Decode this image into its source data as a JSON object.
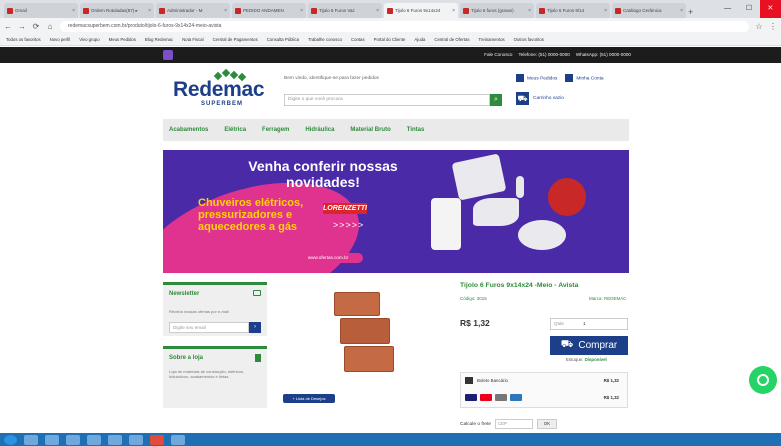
{
  "browser": {
    "tabs": [
      {
        "label": "Gmail",
        "active": false
      },
      {
        "label": "Ordem Rotuladas(87) ▸",
        "active": false
      },
      {
        "label": "Administrador - M",
        "active": false
      },
      {
        "label": "PEDIDO ANDAMEN",
        "active": false
      },
      {
        "label": "Tijolo 6 Furos Vaz",
        "active": false
      },
      {
        "label": "Tijolo 6 Furos 9x14x24",
        "active": true
      },
      {
        "label": "Tijolo 6 furos (gravar)",
        "active": false
      },
      {
        "label": "Tijolo 6 Furos 9/14",
        "active": false
      },
      {
        "label": "Catálogo Cerâmica",
        "active": false
      }
    ],
    "url": "redemacsuperbem.com.br/produto/tijolo-6-furos-9x14x24-meio-avista",
    "bookmarks": [
      "Todos os favoritos",
      "Novo perfil",
      "Vivo grupo",
      "Meus Pedidos",
      "Blog Redemac",
      "Nota Fiscal",
      "Central de Pagamentos",
      "Consulta Pública",
      "Trabalhe conosco",
      "Contas",
      "Portal do Cliente",
      "Ajuda",
      "Central de Ofertas",
      "Treinamentos",
      "Outros favoritos"
    ]
  },
  "topbar": {
    "info": [
      "Fale Conosco",
      "Telefone: (51) 0000-0000",
      "WhatsApp: (51) 0000-0000"
    ]
  },
  "header": {
    "logo": "Redemac",
    "logo_sub": "SUPERBEM",
    "welcome": "Bem vindo, identifique-se para fazer pedidos",
    "search_placeholder": "Digite o que você procura",
    "my_orders": "Meus Pedidos",
    "my_account": "Minha Conta",
    "cart": "Carrinho vazio"
  },
  "menu": [
    "Acabamentos",
    "Elétrica",
    "Ferragem",
    "Hidráulica",
    "Material Bruto",
    "Tintas"
  ],
  "banner": {
    "headline": "Venha conferir nossas novidades!",
    "subline": "Chuveiros elétricos, pressurizadores e aquecedores a gás",
    "brand": "LORENZETTI",
    "arrows": ">>>>>",
    "url": "www.ofertas.com.br"
  },
  "newsletter": {
    "title": "Newsletter",
    "desc": "Receba nossas ofertas por e-mail",
    "placeholder": "Digite seu email",
    "go": "›"
  },
  "about": {
    "title": "Sobre a loja",
    "text": "Loja de materiais de construção, elétricos, hidráulicos, acabamentos e tintas."
  },
  "product": {
    "badge": "+ Lista de Desejos",
    "title": "Tijolo 6 Furos 9x14x24 -Meio - Avista",
    "sku": "Código: 3015",
    "brand": "Marca: REDEMAC",
    "price": "R$ 1,32",
    "qty_label": "Qtde",
    "qty_value": "1",
    "buy_label": "Comprar",
    "avail_label": "Estoque:",
    "avail_value": "Disponível",
    "pay_row1_label": "Boleto Bancário",
    "pay_row1_price": "R$ 1,32",
    "pay_row2_price": "R$ 1,32",
    "shipping_label": "Calcule o frete",
    "cep_placeholder": "CEP",
    "ok": "OK"
  }
}
